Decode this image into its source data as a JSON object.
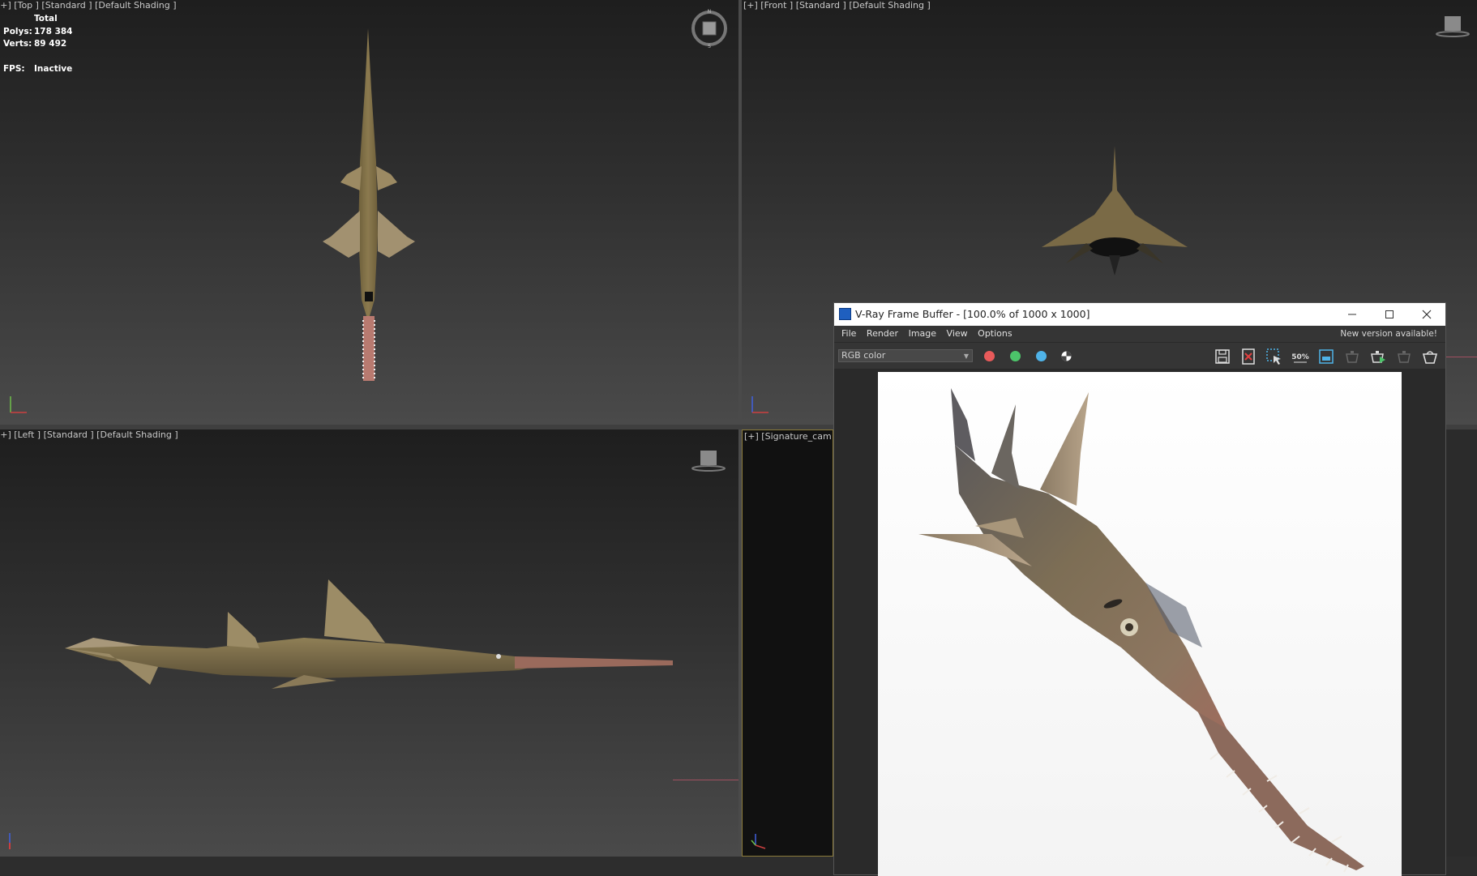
{
  "viewports": {
    "top": {
      "label": "[+] [Top ] [Standard ] [Default Shading ]"
    },
    "front": {
      "label": "[+] [Front ] [Standard ] [Default Shading ]"
    },
    "left": {
      "label": "[+] [Left ] [Standard ] [Default Shading ]"
    },
    "camera": {
      "label": "[+] [Signature_cam ]"
    }
  },
  "stats": {
    "header": "Total",
    "polys_label": "Polys:",
    "polys_value": "178 384",
    "verts_label": "Verts:",
    "verts_value": "89 492",
    "fps_label": "FPS:",
    "fps_value": "Inactive"
  },
  "vfb": {
    "title": "V-Ray Frame Buffer - [100.0% of 1000 x 1000]",
    "menu": [
      "File",
      "Render",
      "Image",
      "View",
      "Options"
    ],
    "notice": "New version available!",
    "channel_select": "RGB color",
    "zoom_icon_text": "50%",
    "channel_colors": {
      "red": "#e85a5a",
      "green": "#4cc46a",
      "blue": "#4fb3e8"
    }
  },
  "icons": [
    "viewcube-icon",
    "axis-tripod-icon",
    "minimize-icon",
    "maximize-icon",
    "close-icon",
    "save-image-icon",
    "clear-image-icon",
    "region-render-icon",
    "zoom-50-icon",
    "compare-icon",
    "render-last-icon",
    "render-interactive-icon",
    "render-icon"
  ]
}
